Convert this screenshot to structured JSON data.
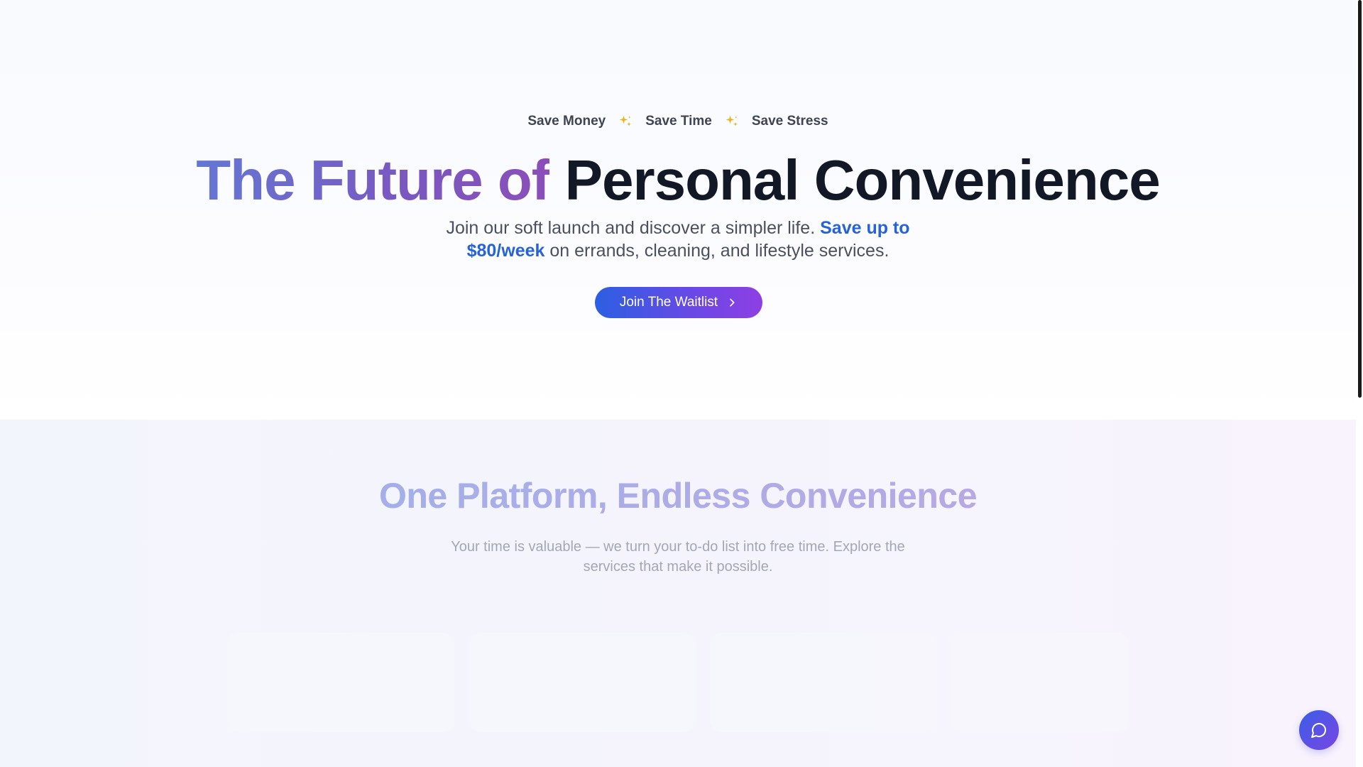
{
  "hero": {
    "taglines": [
      "Save Money",
      "Save Time",
      "Save Stress"
    ],
    "title_gradient": "The Future of",
    "title_dark": "Personal Convenience",
    "subtitle_pre": "Join our soft launch and discover a simpler life.",
    "subtitle_highlight": "Save up to $80/week",
    "subtitle_post": "on errands, cleaning, and lifestyle services.",
    "cta_label": "Join The Waitlist"
  },
  "services": {
    "title": "One Platform, Endless Convenience",
    "subtitle": "Your time is valuable — we turn your to-do list into free time. Explore the services that make it possible."
  },
  "icons": {
    "sparkle": "sparkle-icon",
    "cta_arrow": "chevron-right-icon",
    "chat": "chat-bubble-icon"
  },
  "colors": {
    "accent_blue": "#2662d9",
    "gradient_start": "#2c5fe3",
    "gradient_end": "#8e3fe3",
    "sparkle": "#e8b422",
    "heading_dark": "#121826"
  }
}
